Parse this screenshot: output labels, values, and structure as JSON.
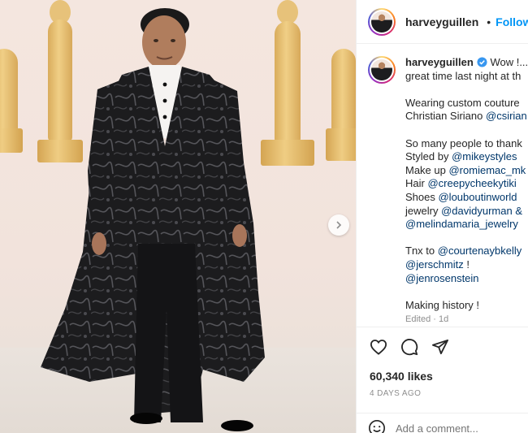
{
  "post": {
    "username": "harveyguillen",
    "follow_label": "Follow",
    "dot": "•",
    "caption_lines": [
      {
        "type": "first",
        "text": "Wow !..."
      },
      {
        "type": "text",
        "text": "great time last night at th"
      },
      {
        "type": "gap"
      },
      {
        "type": "text",
        "text": "Wearing custom couture"
      },
      {
        "type": "mixed",
        "text": "Christian Siriano ",
        "link": "@csirian"
      },
      {
        "type": "gap"
      },
      {
        "type": "text",
        "text": "So many people to thank"
      },
      {
        "type": "mixed",
        "text": "Styled by ",
        "link": "@mikeystyles"
      },
      {
        "type": "mixed",
        "text": "Make up ",
        "link": "@romiemac_mk"
      },
      {
        "type": "mixed",
        "text": "Hair ",
        "link": "@creepycheekytiki"
      },
      {
        "type": "mixed",
        "text": "Shoes ",
        "link": "@louboutinworld"
      },
      {
        "type": "mixed",
        "text": "jewelry ",
        "link": "@davidyurman &"
      },
      {
        "type": "link",
        "link": "@melindamaria_jewelry"
      },
      {
        "type": "gap"
      },
      {
        "type": "mixed",
        "text": "Tnx to ",
        "link": "@courtenaybkelly"
      },
      {
        "type": "mixedafter",
        "link": "@jerschmitz",
        "text": " !"
      },
      {
        "type": "link",
        "link": "@jenrosenstein"
      },
      {
        "type": "gap"
      },
      {
        "type": "text",
        "text": "Making history !"
      },
      {
        "type": "edited",
        "text": "Edited · 1d"
      }
    ],
    "likes": "60,340 likes",
    "date": "4 DAYS AGO",
    "comment_placeholder": "Add a comment..."
  },
  "icons": {
    "verified": "verified-badge-icon",
    "like": "heart-icon",
    "comment": "comment-icon",
    "share": "paper-plane-icon",
    "next": "chevron-right-icon",
    "emoji": "smiley-icon"
  },
  "colors": {
    "link": "#00376b",
    "follow": "#0095f6",
    "verified": "#3897f0",
    "muted": "#8e8e8e",
    "gold": "#e0b465",
    "suit": "#1c1c1e"
  }
}
